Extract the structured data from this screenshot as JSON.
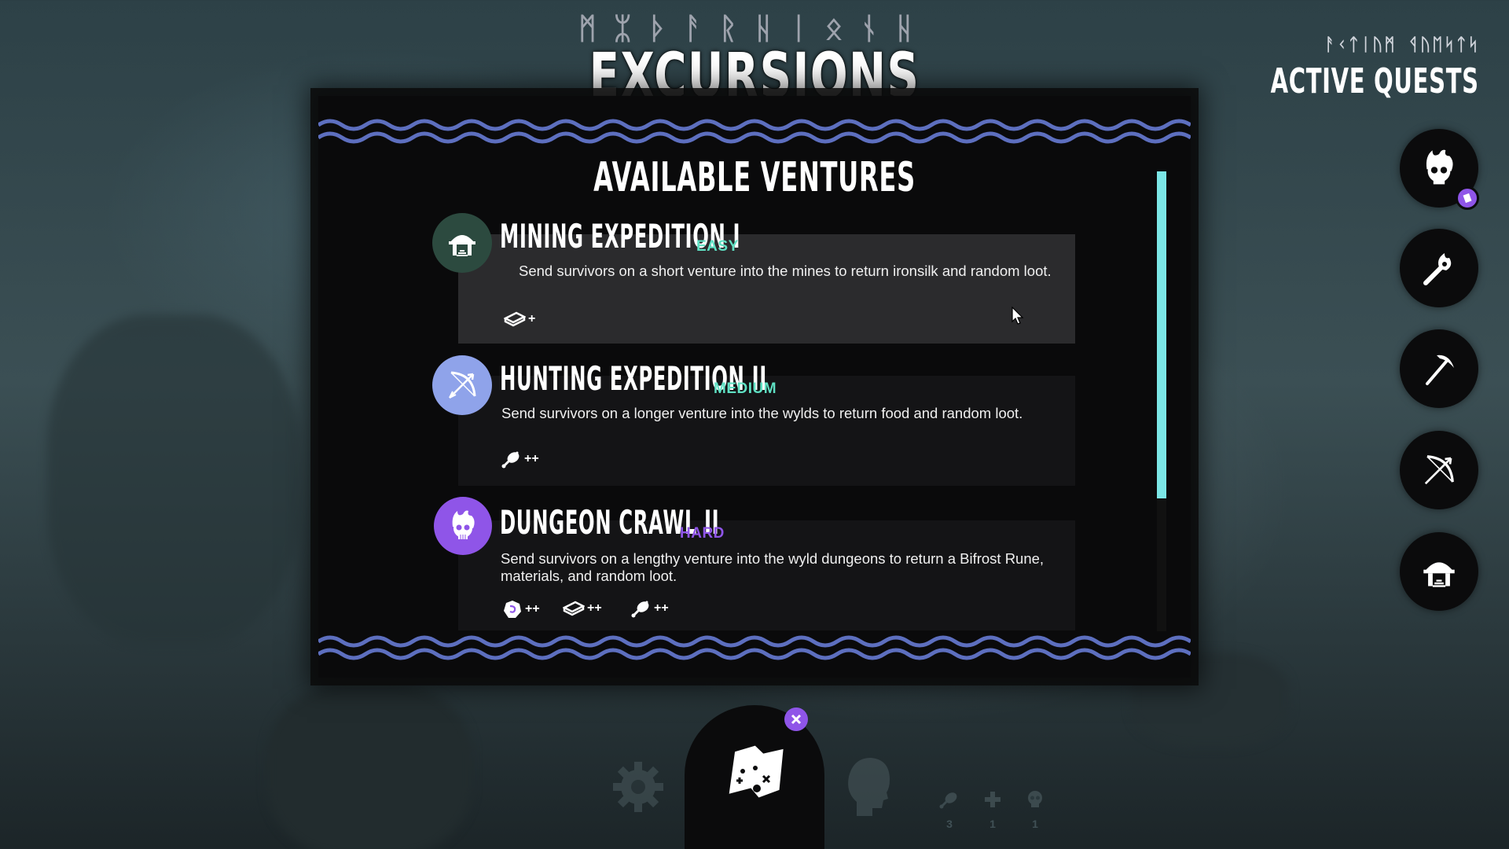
{
  "header": {
    "runes": "ᛗᛯᚦᚨᚱᚺᛁᛟᚾᚺ",
    "title": "EXCURSIONS"
  },
  "panel": {
    "title": "AVAILABLE VENTURES"
  },
  "quests": [
    {
      "title": "MINING EXPEDITION I",
      "difficulty": "EASY",
      "difficulty_color": "#5fe0c3",
      "description": "Send survivors on a short venture into the mines to return ironsilk and random loot.",
      "icon": "mine-icon",
      "rewards": [
        {
          "icon": "ingot-icon",
          "amount": "+"
        }
      ]
    },
    {
      "title": "HUNTING EXPEDITION II",
      "difficulty": "MEDIUM",
      "difficulty_color": "#5fe0c3",
      "description": "Send survivors on a longer venture into the wylds to return food and random loot.",
      "icon": "bow-icon",
      "rewards": [
        {
          "icon": "meat-icon",
          "amount": "++"
        }
      ]
    },
    {
      "title": "DUNGEON CRAWL II",
      "difficulty": "HARD",
      "difficulty_color": "#8f55e8",
      "description": "Send survivors on a lengthy venture into the wyld dungeons to return a Bifrost Rune, materials, and random loot.",
      "icon": "flaming-skull-icon",
      "rewards": [
        {
          "icon": "rune-icon",
          "amount": "++"
        },
        {
          "icon": "ingot-icon",
          "amount": "++"
        },
        {
          "icon": "meat-icon",
          "amount": "++"
        }
      ]
    }
  ],
  "active_quests": {
    "runes": "ᚨᚲᛏᛁᚢᛗ ᛩᚢᛖᛋᛏᛋ",
    "title": "ACTIVE QUESTS",
    "items": [
      {
        "icon": "flaming-skull-icon"
      },
      {
        "icon": "torch-icon"
      },
      {
        "icon": "pickaxe-icon"
      },
      {
        "icon": "bow-icon"
      },
      {
        "icon": "mine-icon"
      }
    ]
  },
  "bottom_nav": {
    "active": "map-icon",
    "items": [
      {
        "icon": "gear-icon"
      },
      {
        "icon": "map-icon"
      },
      {
        "icon": "head-icon"
      }
    ]
  },
  "stats": [
    {
      "icon": "meat-icon",
      "value": "3"
    },
    {
      "icon": "health-cross-icon",
      "value": "1"
    },
    {
      "icon": "skull-icon",
      "value": "1"
    }
  ],
  "colors": {
    "accent_purple": "#8f55e8",
    "accent_teal": "#5fe0c3",
    "wave_blue": "#5d6fbf",
    "scroll_cyan": "#7be6e6"
  }
}
